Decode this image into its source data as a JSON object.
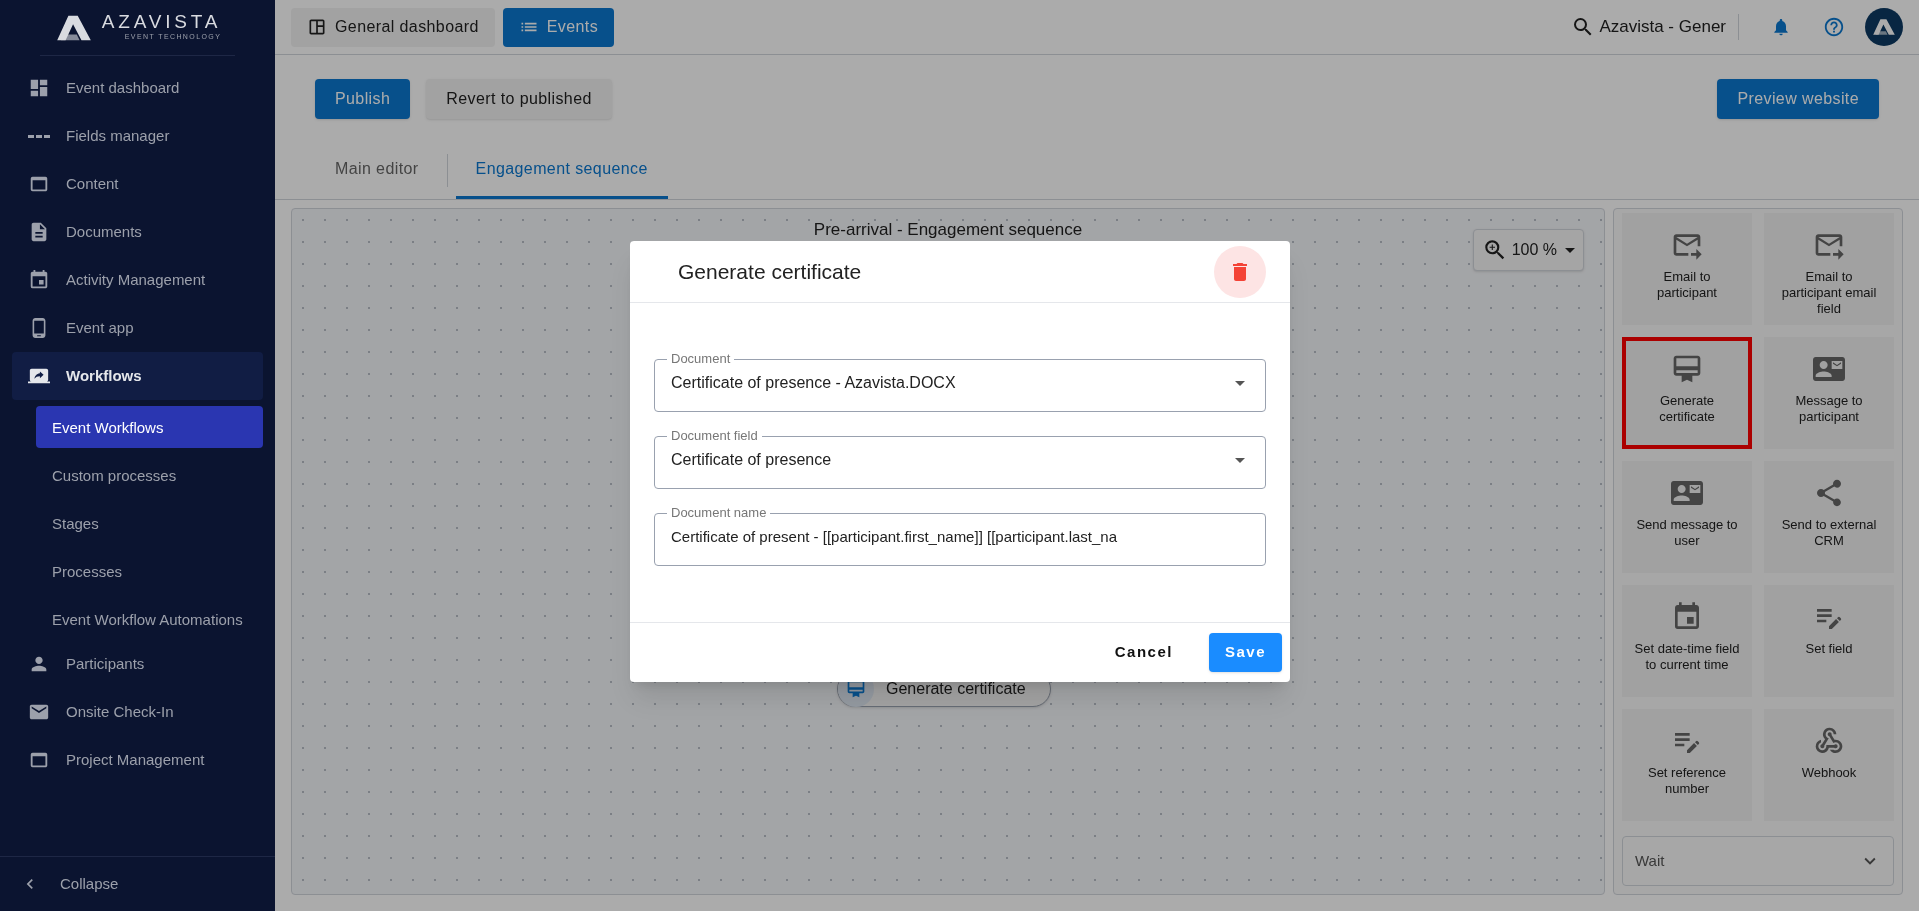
{
  "brand": {
    "name": "AZAVISTA",
    "tagline": "EVENT TECHNOLOGY"
  },
  "sidebar": {
    "items": [
      {
        "label": "Event dashboard",
        "kind": "dashboard",
        "selected": false
      },
      {
        "label": "Fields manager",
        "kind": "fields",
        "selected": false
      },
      {
        "label": "Content",
        "kind": "content",
        "selected": false
      },
      {
        "label": "Documents",
        "kind": "document",
        "selected": false
      },
      {
        "label": "Activity Management",
        "kind": "calendar",
        "selected": false
      },
      {
        "label": "Event app",
        "kind": "phone",
        "selected": false
      },
      {
        "label": "Workflows",
        "kind": "workflow",
        "selected": true,
        "expanded": true,
        "children": [
          {
            "label": "Event Workflows",
            "selected": true
          },
          {
            "label": "Custom processes",
            "selected": false
          },
          {
            "label": "Stages",
            "selected": false
          },
          {
            "label": "Processes",
            "selected": false
          },
          {
            "label": "Event Workflow Automations",
            "selected": false
          }
        ]
      },
      {
        "label": "Participants",
        "kind": "person",
        "selected": false
      },
      {
        "label": "Onsite Check-In",
        "kind": "mail",
        "selected": false
      },
      {
        "label": "Project Management",
        "kind": "content",
        "selected": false
      }
    ],
    "collapse": "Collapse"
  },
  "topbar": {
    "tabs": [
      {
        "label": "General dashboard",
        "kind": "grid",
        "selected": false
      },
      {
        "label": "Events",
        "kind": "list",
        "selected": true
      }
    ],
    "search": "Azavista - Gener"
  },
  "actions": {
    "left": [
      "Publish",
      "Revert to published"
    ],
    "right": "Preview website"
  },
  "editor_tabs": [
    {
      "label": "Main editor",
      "selected": false
    },
    {
      "label": "Engagement sequence",
      "selected": true
    }
  ],
  "canvas": {
    "title": "Pre-arrival - Engagement sequence",
    "zoom": "100 %",
    "node": "Generate certificate"
  },
  "palette": {
    "items": [
      {
        "label": "Email to participant",
        "kind": "email-forward",
        "highlighted": false
      },
      {
        "label": "Email to participant email field",
        "kind": "email-forward",
        "highlighted": false
      },
      {
        "label": "Generate certificate",
        "kind": "certificate",
        "highlighted": true
      },
      {
        "label": "Message to participant",
        "kind": "contact",
        "highlighted": false
      },
      {
        "label": "Send message to user",
        "kind": "contact",
        "highlighted": false
      },
      {
        "label": "Send to external CRM",
        "kind": "share",
        "highlighted": false
      },
      {
        "label": "Set date-time field to current time",
        "kind": "calendar",
        "highlighted": false
      },
      {
        "label": "Set field",
        "kind": "edit-list",
        "highlighted": false
      },
      {
        "label": "Set reference number",
        "kind": "edit-list",
        "highlighted": false
      },
      {
        "label": "Webhook",
        "kind": "webhook",
        "highlighted": false
      }
    ],
    "wait": {
      "label": "Wait",
      "expanded": false
    }
  },
  "modal": {
    "title": "Generate certificate",
    "fields": [
      {
        "label": "Document",
        "value": "Certificate of presence - Azavista.DOCX",
        "kind": "select"
      },
      {
        "label": "Document field",
        "value": "Certificate of presence",
        "kind": "select"
      },
      {
        "label": "Document name",
        "value": "Certificate of present - [[participant.first_name]] [[participant.last_na",
        "kind": "text"
      }
    ],
    "buttons": [
      "Cancel",
      "Save"
    ]
  }
}
